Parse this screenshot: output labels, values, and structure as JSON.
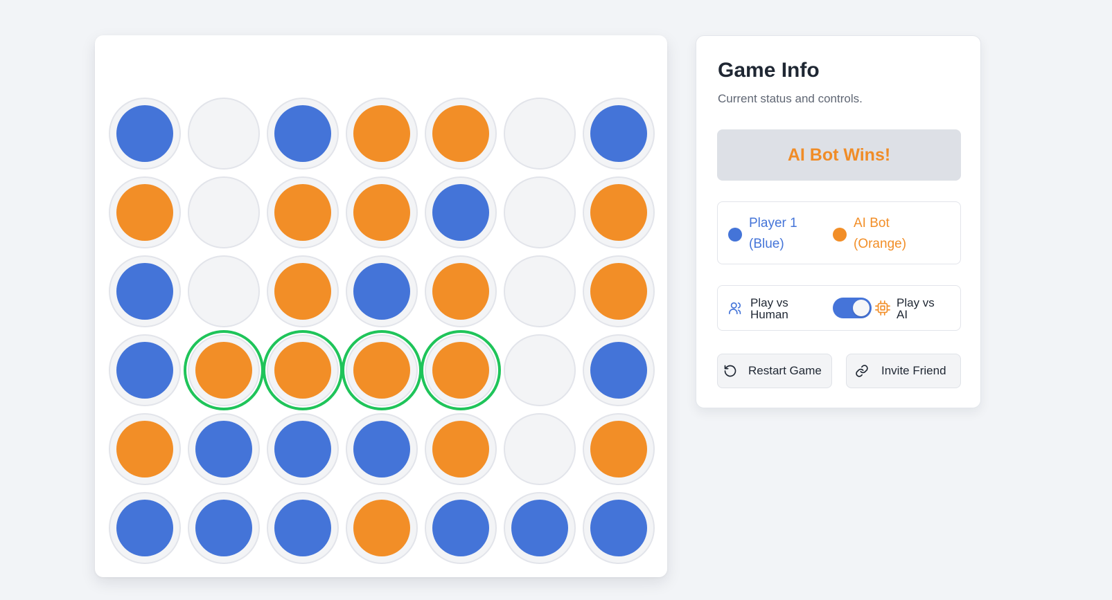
{
  "board": {
    "rows": [
      [
        "blue",
        "empty",
        "blue",
        "orange",
        "orange",
        "empty",
        "blue"
      ],
      [
        "orange",
        "empty",
        "orange",
        "orange",
        "blue",
        "empty",
        "orange"
      ],
      [
        "blue",
        "empty",
        "orange",
        "blue",
        "orange",
        "empty",
        "orange"
      ],
      [
        "blue",
        "orange",
        "orange",
        "orange",
        "orange",
        "empty",
        "blue"
      ],
      [
        "orange",
        "blue",
        "blue",
        "blue",
        "orange",
        "empty",
        "orange"
      ],
      [
        "blue",
        "blue",
        "blue",
        "orange",
        "blue",
        "blue",
        "blue"
      ]
    ],
    "winning_cells": [
      [
        3,
        1
      ],
      [
        3,
        2
      ],
      [
        3,
        3
      ],
      [
        3,
        4
      ]
    ]
  },
  "colors": {
    "blue": "#4474d8",
    "orange": "#f28e27",
    "win_ring": "#1fc45a"
  },
  "panel": {
    "title": "Game Info",
    "subtitle": "Current status and controls.",
    "status": "AI Bot Wins!",
    "legend": [
      {
        "label": "Player 1 (Blue)",
        "color": "#4474d8"
      },
      {
        "label": "AI Bot (Orange)",
        "color": "#f28e27"
      }
    ],
    "mode": {
      "human_label": "Play vs Human",
      "ai_label": "Play vs AI",
      "ai_enabled": true
    },
    "buttons": {
      "restart": "Restart Game",
      "invite": "Invite Friend"
    }
  }
}
